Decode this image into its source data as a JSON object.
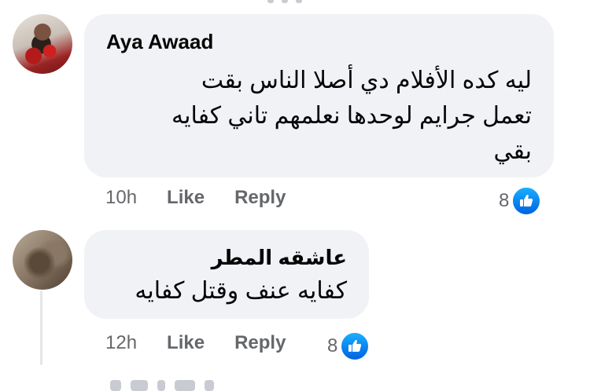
{
  "comments": [
    {
      "author": "Aya Awaad",
      "text_lines": [
        "ليه كده الأفلام دي أصلا الناس بقت",
        "تعمل جرايم لوحدها نعلمهم تاني كفايه",
        "بقي"
      ],
      "time": "10h",
      "like_label": "Like",
      "reply_label": "Reply",
      "reaction_count": "8"
    },
    {
      "author": "عاشقه المطر",
      "text_lines": [
        "كفايه عنف وقتل كفايه"
      ],
      "time": "12h",
      "like_label": "Like",
      "reply_label": "Reply",
      "reaction_count": "8"
    }
  ],
  "colors": {
    "bubble_bg": "#f0f2f5",
    "meta_text": "#65676b",
    "like_blue": "#0866ff"
  },
  "icons": {
    "reaction": "like-thumb-icon"
  }
}
